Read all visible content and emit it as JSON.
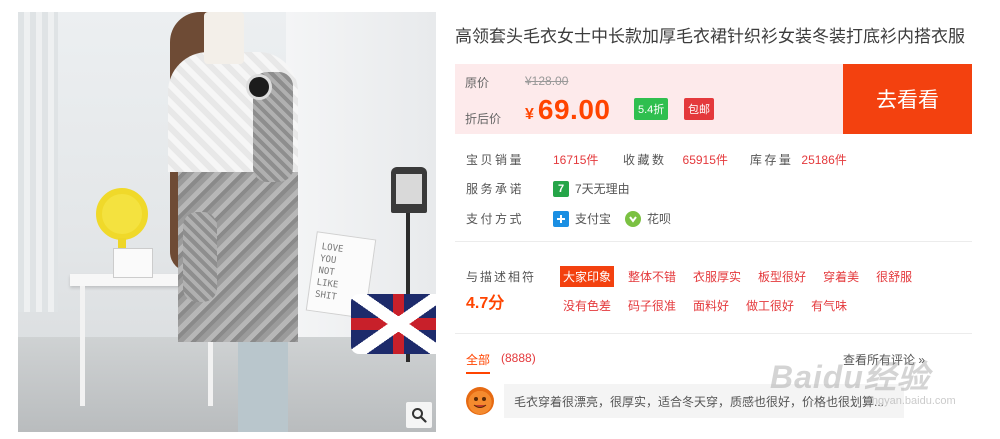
{
  "product": {
    "title": "高领套头毛衣女士中长款加厚毛衣裙针织衫女装冬装打底衫内搭衣服"
  },
  "image": {
    "bag_text": "LOVE\nYOU\nNOT\nLIKE\nSHIT"
  },
  "price": {
    "original_label": "原价",
    "original_value": "¥128.00",
    "discount_label": "折后价",
    "currency": "¥",
    "current_value": "69.00",
    "discount_badge": "5.4折",
    "shipping_badge": "包邮"
  },
  "buy_button": {
    "label": "去看看"
  },
  "stats": {
    "sales_label": "宝贝销量",
    "sales_value": "16715件",
    "fav_label": "收藏数",
    "fav_value": "65915件",
    "stock_label": "库存量",
    "stock_value": "25186件"
  },
  "service": {
    "label": "服务承诺",
    "icon_text": "7",
    "text": "7天无理由"
  },
  "payment": {
    "label": "支付方式",
    "alipay": "支付宝",
    "huabei": "花呗"
  },
  "rating": {
    "label": "与描述相符",
    "value": "4.7分",
    "tags": [
      "大家印象",
      "整体不错",
      "衣服厚实",
      "板型很好",
      "穿着美",
      "很舒服",
      "没有色差",
      "码子很准",
      "面料好",
      "做工很好",
      "有气味"
    ]
  },
  "reviews": {
    "tab_all": "全部",
    "count": "(8888)",
    "view_more": "查看所有评论 »",
    "comment": "毛衣穿着很漂亮，很厚实，适合冬天穿，质感也很好，价格也很划算..."
  },
  "watermark": {
    "text": "Baidu经验",
    "sub": "jingyan.baidu.com"
  },
  "colors": {
    "accent": "#f3410f",
    "price_red": "#ff4400",
    "price_bg": "#fdeaeb",
    "discount_green": "#2fbf4f"
  }
}
